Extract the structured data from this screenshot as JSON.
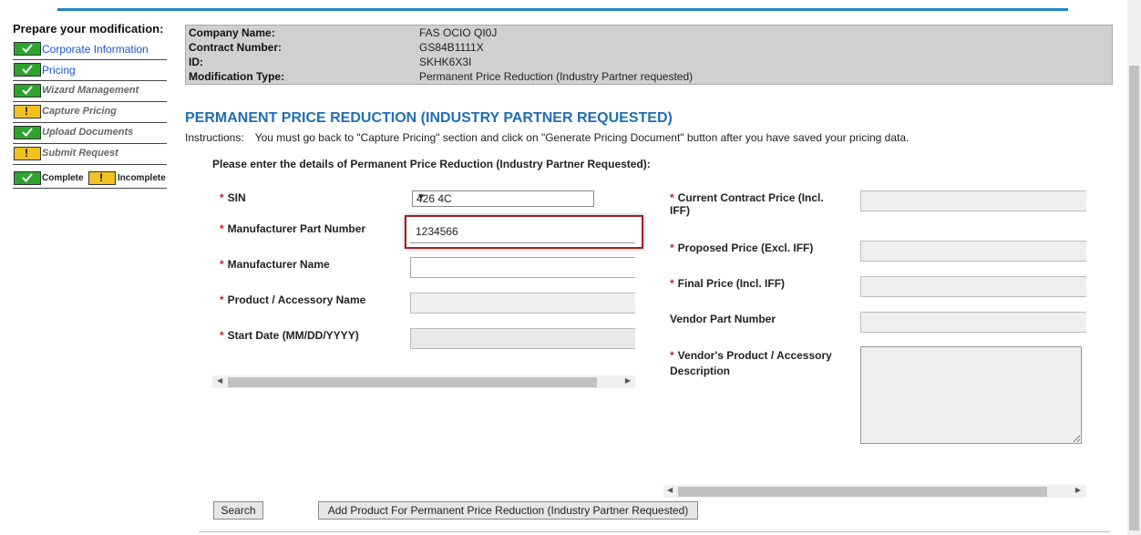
{
  "sidebar": {
    "title": "Prepare your modification:",
    "items": [
      {
        "label": "Corporate Information",
        "status": "complete",
        "style": "link"
      },
      {
        "label": "Pricing",
        "status": "complete",
        "style": "link"
      },
      {
        "label": "Wizard Management",
        "status": "complete",
        "style": "gray"
      },
      {
        "label": "Capture Pricing",
        "status": "incomplete",
        "style": "gray"
      },
      {
        "label": "Upload Documents",
        "status": "complete",
        "style": "gray"
      },
      {
        "label": "Submit Request",
        "status": "incomplete",
        "style": "gray"
      }
    ],
    "legend": {
      "complete": "Complete",
      "incomplete": "Incomplete"
    }
  },
  "info": {
    "company_label": "Company Name:",
    "company_value": "FAS OCIO QI0J",
    "contract_label": "Contract Number:",
    "contract_value": "GS84B1111X",
    "id_label": "ID:",
    "id_value": "SKHK6X3I",
    "modtype_label": "Modification Type:",
    "modtype_value": "Permanent Price Reduction (Industry Partner requested)"
  },
  "heading": "PERMANENT PRICE REDUCTION (INDUSTRY PARTNER REQUESTED)",
  "instructions": {
    "label": "Instructions:",
    "text": "You must go back to \"Capture Pricing\" section and click on \"Generate Pricing Document\" button after you have saved your pricing data."
  },
  "form": {
    "intro": "Please enter the details of Permanent Price Reduction (Industry Partner Requested):",
    "required_mark": "*",
    "sin_label": "SIN",
    "sin_value": "426 4C",
    "mpn_label": "Manufacturer Part Number",
    "mpn_value": "1234566",
    "mfr_name_label": "Manufacturer Name",
    "mfr_name_value": "",
    "product_label": "Product / Accessory Name",
    "start_date_label": "Start Date (MM/DD/YYYY)",
    "current_price_label_1": "Current Contract Price (Incl.",
    "current_price_label_2": "IFF)",
    "proposed_price_label": "Proposed Price (Excl. IFF)",
    "final_price_label": "Final Price (Incl. IFF)",
    "vendor_part_label": "Vendor Part Number",
    "vendor_desc_label_1": "Vendor's Product / Accessory",
    "vendor_desc_label_2": "Description"
  },
  "buttons": {
    "search": "Search",
    "add_product": "Add Product For Permanent Price Reduction (Industry Partner Requested)"
  },
  "colors": {
    "accent": "#1f6fb2",
    "topbar": "#1e88c8",
    "complete": "#2ea32e",
    "incomplete": "#f2c320",
    "highlight": "#a41e22"
  }
}
